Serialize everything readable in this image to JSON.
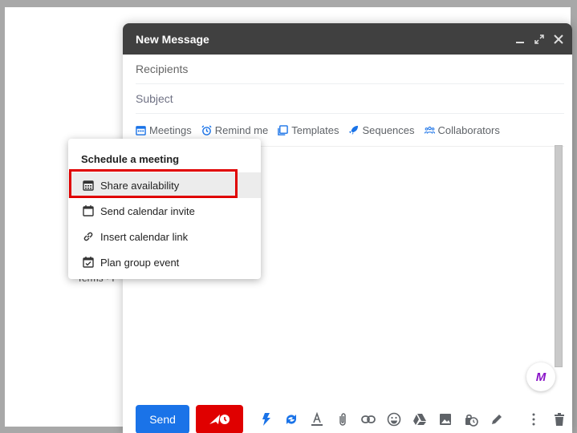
{
  "background": {
    "terms_fragment": "Terms · P"
  },
  "compose": {
    "title": "New Message",
    "header_icons": [
      "minimize-icon",
      "expand-icon",
      "close-icon"
    ],
    "recipients_placeholder": "Recipients",
    "subject_placeholder": "Subject",
    "toolbar": [
      {
        "icon": "calendar-icon",
        "label": "Meetings"
      },
      {
        "icon": "alarm-clock-icon",
        "label": "Remind me"
      },
      {
        "icon": "templates-icon",
        "label": "Templates"
      },
      {
        "icon": "rocket-icon",
        "label": "Sequences"
      },
      {
        "icon": "people-icon",
        "label": "Collaborators"
      }
    ],
    "badge": "M",
    "send_label": "Send",
    "bottom_icons": [
      "lightning-icon",
      "sync-icon",
      "text-format-icon",
      "attach-icon",
      "link-icon",
      "emoji-icon",
      "drive-icon",
      "photo-icon",
      "confidential-icon",
      "signature-icon",
      "more-options-icon",
      "trash-icon"
    ]
  },
  "menu": {
    "title": "Schedule a meeting",
    "items": [
      {
        "icon": "calendar-grid-icon",
        "label": "Share availability",
        "highlighted": true
      },
      {
        "icon": "calendar-icon",
        "label": "Send calendar invite"
      },
      {
        "icon": "link-icon",
        "label": "Insert calendar link"
      },
      {
        "icon": "calendar-check-icon",
        "label": "Plan group event"
      }
    ]
  },
  "colors": {
    "header": "#404040",
    "send": "#1a73e8",
    "schedule": "#e00000",
    "highlight_border": "#e00000",
    "accent_blue": "#1a73e8"
  }
}
